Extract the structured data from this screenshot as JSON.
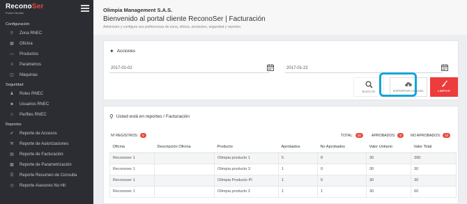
{
  "brand": {
    "name_a": "Recono",
    "name_b": "Ser",
    "sub": "Portal Clientes"
  },
  "sidebar": {
    "sections": [
      {
        "title": "Configuración",
        "items": [
          {
            "label": "Zona RNEC",
            "icon": "map-marker-icon"
          },
          {
            "label": "Oficina",
            "icon": "building-icon"
          },
          {
            "label": "Productos",
            "icon": "card-icon"
          },
          {
            "label": "Parámetros",
            "icon": "sliders-icon"
          },
          {
            "label": "Maquinas",
            "icon": "monitor-icon"
          }
        ]
      },
      {
        "title": "Seguridad",
        "items": [
          {
            "label": "Roles RNEC",
            "icon": "users-icon"
          },
          {
            "label": "Usuarios RNEC",
            "icon": "user-icon"
          },
          {
            "label": "Perfiles RNEC",
            "icon": "profile-icon"
          }
        ]
      },
      {
        "title": "Reportes",
        "items": [
          {
            "label": "Reporte de Accesos",
            "icon": "check-icon"
          },
          {
            "label": "Reporte de Autorizaciones",
            "icon": "wrench-icon"
          },
          {
            "label": "Reporte de Facturación",
            "icon": "file-icon"
          },
          {
            "label": "Reporte de Parametrización",
            "icon": "chart-icon"
          },
          {
            "label": "Reporte Resumen de Consulta",
            "icon": "list-icon"
          },
          {
            "label": "Reporte Asesores No Hit",
            "icon": "clock-icon"
          }
        ]
      }
    ]
  },
  "header": {
    "company": "Olimpia Management S.A.S.",
    "welcome": "Bienvenido al portal cliente ReconoSer | Facturación",
    "subtitle": "Administre y configure sus preferencias de zona, oficina, productos, seguridad y reportes."
  },
  "actions": {
    "title": "Acciones",
    "date_from": "2017-01-02",
    "date_to": "2017-01-22",
    "buscar": "BUSCAR",
    "exportar": "EXPORTAR A EXCEL",
    "limpiar": "LIMPIAR"
  },
  "report": {
    "location": "Usted está en reportes / Facturación",
    "registros_label": "Nº REGISTROS:",
    "registros_value": "5",
    "total_label": "TOTAL:",
    "total_value": "10",
    "aprobados_label": "APROBADOS:",
    "aprobados_value": "9",
    "no_aprobados_label": "NO APROBADOS:",
    "no_aprobados_value": "10",
    "columns": [
      "Oficina",
      "Descripción Oficina",
      "Producto",
      "Aprobados",
      "No Aprobados",
      "Valor Unitario",
      "Valor Total"
    ],
    "rows": [
      [
        "Reconoser 1",
        "",
        "Olimpia producto 1",
        "5",
        "8",
        "30",
        "390"
      ],
      [
        "Reconoser 1",
        "",
        "Olimpia producto 3",
        "1",
        "0",
        "30",
        "30"
      ],
      [
        "Reconoser 1",
        "",
        "Olimpia Producto PI",
        "1",
        "0",
        "30",
        "30"
      ],
      [
        "Reconoser 1",
        "",
        "Olimpia producto 2",
        "1",
        "1",
        "30",
        "60"
      ]
    ]
  }
}
